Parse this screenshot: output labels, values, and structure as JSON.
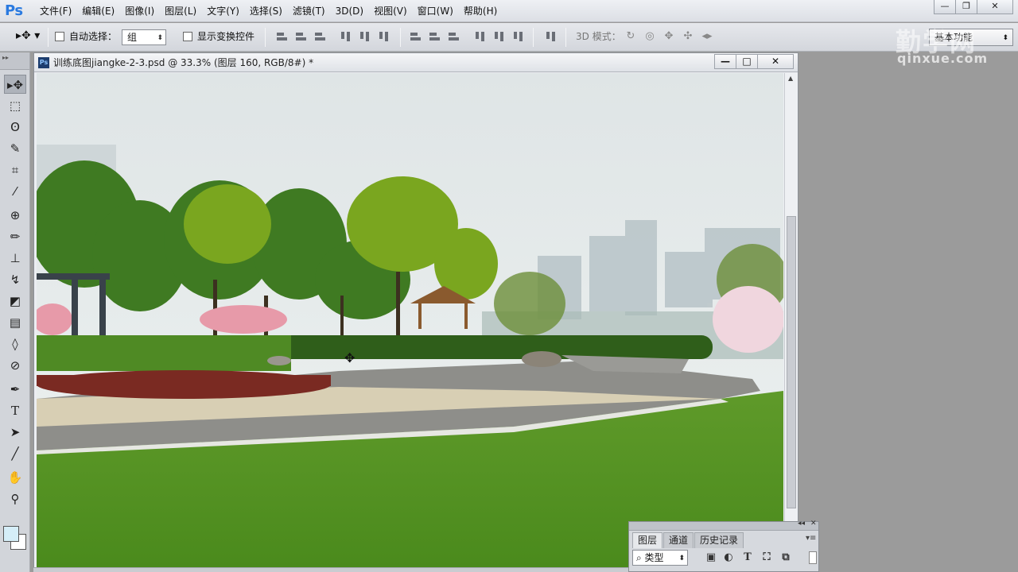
{
  "app": {
    "logo": "Ps"
  },
  "menu": [
    "文件(F)",
    "编辑(E)",
    "图像(I)",
    "图层(L)",
    "文字(Y)",
    "选择(S)",
    "滤镜(T)",
    "3D(D)",
    "视图(V)",
    "窗口(W)",
    "帮助(H)"
  ],
  "window_controls": {
    "minimize": "—",
    "maximize": "❐",
    "close": "✕"
  },
  "options": {
    "auto_select_label": "自动选择：",
    "group_value": "组",
    "show_transform_label": "显示变换控件",
    "mode3d_label": "3D 模式：",
    "workspace_value": "基本功能"
  },
  "watermark": {
    "cn": "勤学网",
    "en": "qinxue.com"
  },
  "document": {
    "title": "训练底图jiangke-2-3.psd @ 33.3% (图层 160, RGB/8#) *",
    "controls": {
      "minimize": "—",
      "maximize": "□",
      "close": "✕"
    }
  },
  "tools": [
    "move-tool",
    "marquee-tool",
    "lasso-tool",
    "quick-selection-tool",
    "crop-tool",
    "eyedropper-tool",
    "healing-brush-tool",
    "brush-tool",
    "clone-stamp-tool",
    "history-brush-tool",
    "eraser-tool",
    "gradient-tool",
    "blur-tool",
    "dodge-tool",
    "pen-tool",
    "type-tool",
    "path-selection-tool",
    "line-tool",
    "hand-tool",
    "zoom-tool"
  ],
  "colors": {
    "foreground": "#d5eef8",
    "background": "#ffffff",
    "accent": "#2a7ae0"
  },
  "panel": {
    "tabs": [
      "图层",
      "通道",
      "历史记录"
    ],
    "kind_value": "类型"
  }
}
